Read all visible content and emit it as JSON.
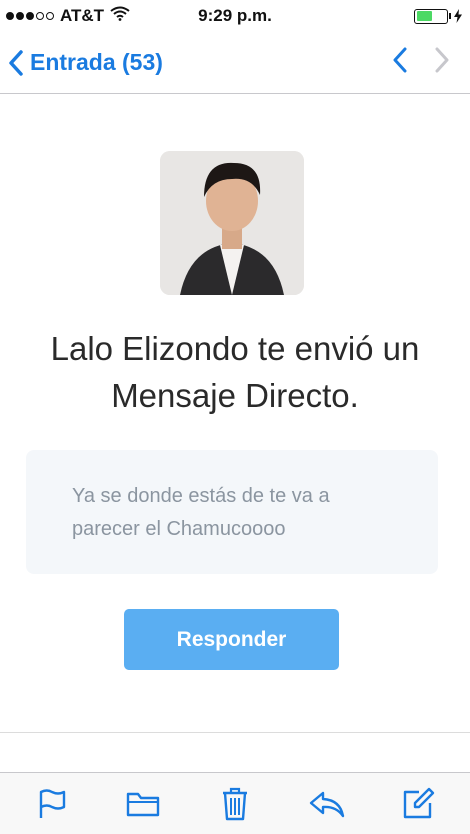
{
  "status_bar": {
    "carrier": "AT&T",
    "time": "9:29 p.m.",
    "signal_icon": "signal-dots-icon",
    "wifi_icon": "wifi-icon",
    "battery_icon": "battery-icon",
    "battery_level": 0.55,
    "battery_color": "#4cd964"
  },
  "nav": {
    "back_label": "Entrada (53)",
    "back_icon": "chevron-left-icon",
    "prev_icon": "chevron-left-icon",
    "next_icon": "chevron-right-icon",
    "accent_color": "#1a7be0"
  },
  "email": {
    "sender_avatar": "avatar",
    "headline_line1": "Lalo Elizondo te envió un",
    "headline_line2": "Mensaje Directo.",
    "message_line1": "Ya se donde estás de te va a",
    "message_line2": "parecer el Chamucoooo",
    "reply_label": "Responder",
    "reply_color": "#5aaef2"
  },
  "toolbar": {
    "items": [
      "flag-icon",
      "folder-icon",
      "trash-icon",
      "reply-icon",
      "compose-icon"
    ]
  }
}
